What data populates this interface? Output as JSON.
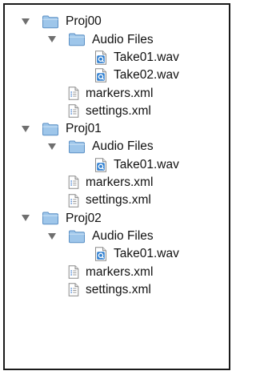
{
  "tree": [
    {
      "label": "Proj00",
      "type": "folder",
      "expanded": true,
      "children": [
        {
          "label": "Audio Files",
          "type": "folder",
          "expanded": true,
          "children": [
            {
              "label": "Take01.wav",
              "type": "audio-file"
            },
            {
              "label": "Take02.wav",
              "type": "audio-file"
            }
          ]
        },
        {
          "label": "markers.xml",
          "type": "xml-file"
        },
        {
          "label": "settings.xml",
          "type": "xml-file"
        }
      ]
    },
    {
      "label": "Proj01",
      "type": "folder",
      "expanded": true,
      "children": [
        {
          "label": "Audio Files",
          "type": "folder",
          "expanded": true,
          "children": [
            {
              "label": "Take01.wav",
              "type": "audio-file"
            }
          ]
        },
        {
          "label": "markers.xml",
          "type": "xml-file"
        },
        {
          "label": "settings.xml",
          "type": "xml-file"
        }
      ]
    },
    {
      "label": "Proj02",
      "type": "folder",
      "expanded": true,
      "children": [
        {
          "label": "Audio Files",
          "type": "folder",
          "expanded": true,
          "children": [
            {
              "label": "Take01.wav",
              "type": "audio-file"
            }
          ]
        },
        {
          "label": "markers.xml",
          "type": "xml-file"
        },
        {
          "label": "settings.xml",
          "type": "xml-file"
        }
      ]
    }
  ],
  "icons": {
    "folder": "folder-icon",
    "audio-file": "audio-file-icon",
    "xml-file": "xml-file-icon",
    "twisty": "disclosure-triangle-icon"
  },
  "colors": {
    "folder_fill": "#9ec6ea",
    "folder_stroke": "#5a8fc4",
    "twisty": "#6f6f6f",
    "audio_badge": "#2f7fd0",
    "border": "#1a1a1a"
  }
}
